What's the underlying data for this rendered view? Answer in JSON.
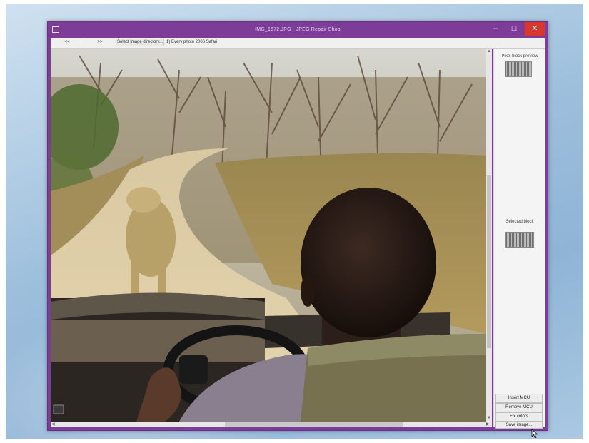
{
  "window": {
    "title": "IMG_1572.JPG - JPEG Repair Shop",
    "min_glyph": "–",
    "max_glyph": "☐",
    "close_glyph": "✕"
  },
  "toolbar": {
    "prev_label": "<<",
    "next_label": ">>",
    "select_dir_label": "Select image directory...",
    "path_text": "1) Every photo 2006 Safari"
  },
  "panel": {
    "pixel_block_preview_label": "Pixel block preview",
    "selected_block_label": "Selected block",
    "buttons": {
      "insert_mcu": "Insert MCU",
      "remove_mcu": "Remove MCU",
      "fix_colors": "Fix colors",
      "save_image": "Save image..."
    }
  },
  "icons": {
    "app": "app-icon",
    "cursor": "mouse-pointer-icon"
  },
  "colors": {
    "title_bar": "#7d3c98",
    "close_button": "#d9372b"
  }
}
